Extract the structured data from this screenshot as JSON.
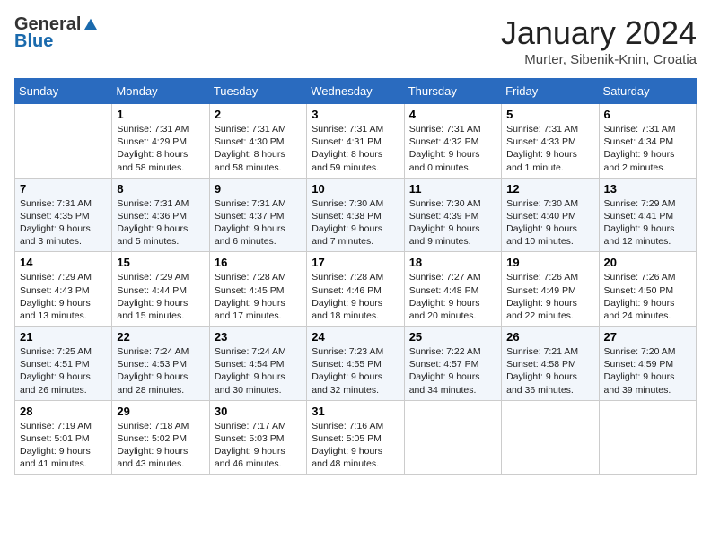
{
  "header": {
    "logo": {
      "general": "General",
      "blue": "Blue"
    },
    "title": "January 2024",
    "location": "Murter, Sibenik-Knin, Croatia"
  },
  "weekdays": [
    "Sunday",
    "Monday",
    "Tuesday",
    "Wednesday",
    "Thursday",
    "Friday",
    "Saturday"
  ],
  "weeks": [
    [
      {
        "day": "",
        "sunrise": "",
        "sunset": "",
        "daylight": ""
      },
      {
        "day": "1",
        "sunrise": "Sunrise: 7:31 AM",
        "sunset": "Sunset: 4:29 PM",
        "daylight": "Daylight: 8 hours and 58 minutes."
      },
      {
        "day": "2",
        "sunrise": "Sunrise: 7:31 AM",
        "sunset": "Sunset: 4:30 PM",
        "daylight": "Daylight: 8 hours and 58 minutes."
      },
      {
        "day": "3",
        "sunrise": "Sunrise: 7:31 AM",
        "sunset": "Sunset: 4:31 PM",
        "daylight": "Daylight: 8 hours and 59 minutes."
      },
      {
        "day": "4",
        "sunrise": "Sunrise: 7:31 AM",
        "sunset": "Sunset: 4:32 PM",
        "daylight": "Daylight: 9 hours and 0 minutes."
      },
      {
        "day": "5",
        "sunrise": "Sunrise: 7:31 AM",
        "sunset": "Sunset: 4:33 PM",
        "daylight": "Daylight: 9 hours and 1 minute."
      },
      {
        "day": "6",
        "sunrise": "Sunrise: 7:31 AM",
        "sunset": "Sunset: 4:34 PM",
        "daylight": "Daylight: 9 hours and 2 minutes."
      }
    ],
    [
      {
        "day": "7",
        "sunrise": "Sunrise: 7:31 AM",
        "sunset": "Sunset: 4:35 PM",
        "daylight": "Daylight: 9 hours and 3 minutes."
      },
      {
        "day": "8",
        "sunrise": "Sunrise: 7:31 AM",
        "sunset": "Sunset: 4:36 PM",
        "daylight": "Daylight: 9 hours and 5 minutes."
      },
      {
        "day": "9",
        "sunrise": "Sunrise: 7:31 AM",
        "sunset": "Sunset: 4:37 PM",
        "daylight": "Daylight: 9 hours and 6 minutes."
      },
      {
        "day": "10",
        "sunrise": "Sunrise: 7:30 AM",
        "sunset": "Sunset: 4:38 PM",
        "daylight": "Daylight: 9 hours and 7 minutes."
      },
      {
        "day": "11",
        "sunrise": "Sunrise: 7:30 AM",
        "sunset": "Sunset: 4:39 PM",
        "daylight": "Daylight: 9 hours and 9 minutes."
      },
      {
        "day": "12",
        "sunrise": "Sunrise: 7:30 AM",
        "sunset": "Sunset: 4:40 PM",
        "daylight": "Daylight: 9 hours and 10 minutes."
      },
      {
        "day": "13",
        "sunrise": "Sunrise: 7:29 AM",
        "sunset": "Sunset: 4:41 PM",
        "daylight": "Daylight: 9 hours and 12 minutes."
      }
    ],
    [
      {
        "day": "14",
        "sunrise": "Sunrise: 7:29 AM",
        "sunset": "Sunset: 4:43 PM",
        "daylight": "Daylight: 9 hours and 13 minutes."
      },
      {
        "day": "15",
        "sunrise": "Sunrise: 7:29 AM",
        "sunset": "Sunset: 4:44 PM",
        "daylight": "Daylight: 9 hours and 15 minutes."
      },
      {
        "day": "16",
        "sunrise": "Sunrise: 7:28 AM",
        "sunset": "Sunset: 4:45 PM",
        "daylight": "Daylight: 9 hours and 17 minutes."
      },
      {
        "day": "17",
        "sunrise": "Sunrise: 7:28 AM",
        "sunset": "Sunset: 4:46 PM",
        "daylight": "Daylight: 9 hours and 18 minutes."
      },
      {
        "day": "18",
        "sunrise": "Sunrise: 7:27 AM",
        "sunset": "Sunset: 4:48 PM",
        "daylight": "Daylight: 9 hours and 20 minutes."
      },
      {
        "day": "19",
        "sunrise": "Sunrise: 7:26 AM",
        "sunset": "Sunset: 4:49 PM",
        "daylight": "Daylight: 9 hours and 22 minutes."
      },
      {
        "day": "20",
        "sunrise": "Sunrise: 7:26 AM",
        "sunset": "Sunset: 4:50 PM",
        "daylight": "Daylight: 9 hours and 24 minutes."
      }
    ],
    [
      {
        "day": "21",
        "sunrise": "Sunrise: 7:25 AM",
        "sunset": "Sunset: 4:51 PM",
        "daylight": "Daylight: 9 hours and 26 minutes."
      },
      {
        "day": "22",
        "sunrise": "Sunrise: 7:24 AM",
        "sunset": "Sunset: 4:53 PM",
        "daylight": "Daylight: 9 hours and 28 minutes."
      },
      {
        "day": "23",
        "sunrise": "Sunrise: 7:24 AM",
        "sunset": "Sunset: 4:54 PM",
        "daylight": "Daylight: 9 hours and 30 minutes."
      },
      {
        "day": "24",
        "sunrise": "Sunrise: 7:23 AM",
        "sunset": "Sunset: 4:55 PM",
        "daylight": "Daylight: 9 hours and 32 minutes."
      },
      {
        "day": "25",
        "sunrise": "Sunrise: 7:22 AM",
        "sunset": "Sunset: 4:57 PM",
        "daylight": "Daylight: 9 hours and 34 minutes."
      },
      {
        "day": "26",
        "sunrise": "Sunrise: 7:21 AM",
        "sunset": "Sunset: 4:58 PM",
        "daylight": "Daylight: 9 hours and 36 minutes."
      },
      {
        "day": "27",
        "sunrise": "Sunrise: 7:20 AM",
        "sunset": "Sunset: 4:59 PM",
        "daylight": "Daylight: 9 hours and 39 minutes."
      }
    ],
    [
      {
        "day": "28",
        "sunrise": "Sunrise: 7:19 AM",
        "sunset": "Sunset: 5:01 PM",
        "daylight": "Daylight: 9 hours and 41 minutes."
      },
      {
        "day": "29",
        "sunrise": "Sunrise: 7:18 AM",
        "sunset": "Sunset: 5:02 PM",
        "daylight": "Daylight: 9 hours and 43 minutes."
      },
      {
        "day": "30",
        "sunrise": "Sunrise: 7:17 AM",
        "sunset": "Sunset: 5:03 PM",
        "daylight": "Daylight: 9 hours and 46 minutes."
      },
      {
        "day": "31",
        "sunrise": "Sunrise: 7:16 AM",
        "sunset": "Sunset: 5:05 PM",
        "daylight": "Daylight: 9 hours and 48 minutes."
      },
      {
        "day": "",
        "sunrise": "",
        "sunset": "",
        "daylight": ""
      },
      {
        "day": "",
        "sunrise": "",
        "sunset": "",
        "daylight": ""
      },
      {
        "day": "",
        "sunrise": "",
        "sunset": "",
        "daylight": ""
      }
    ]
  ]
}
